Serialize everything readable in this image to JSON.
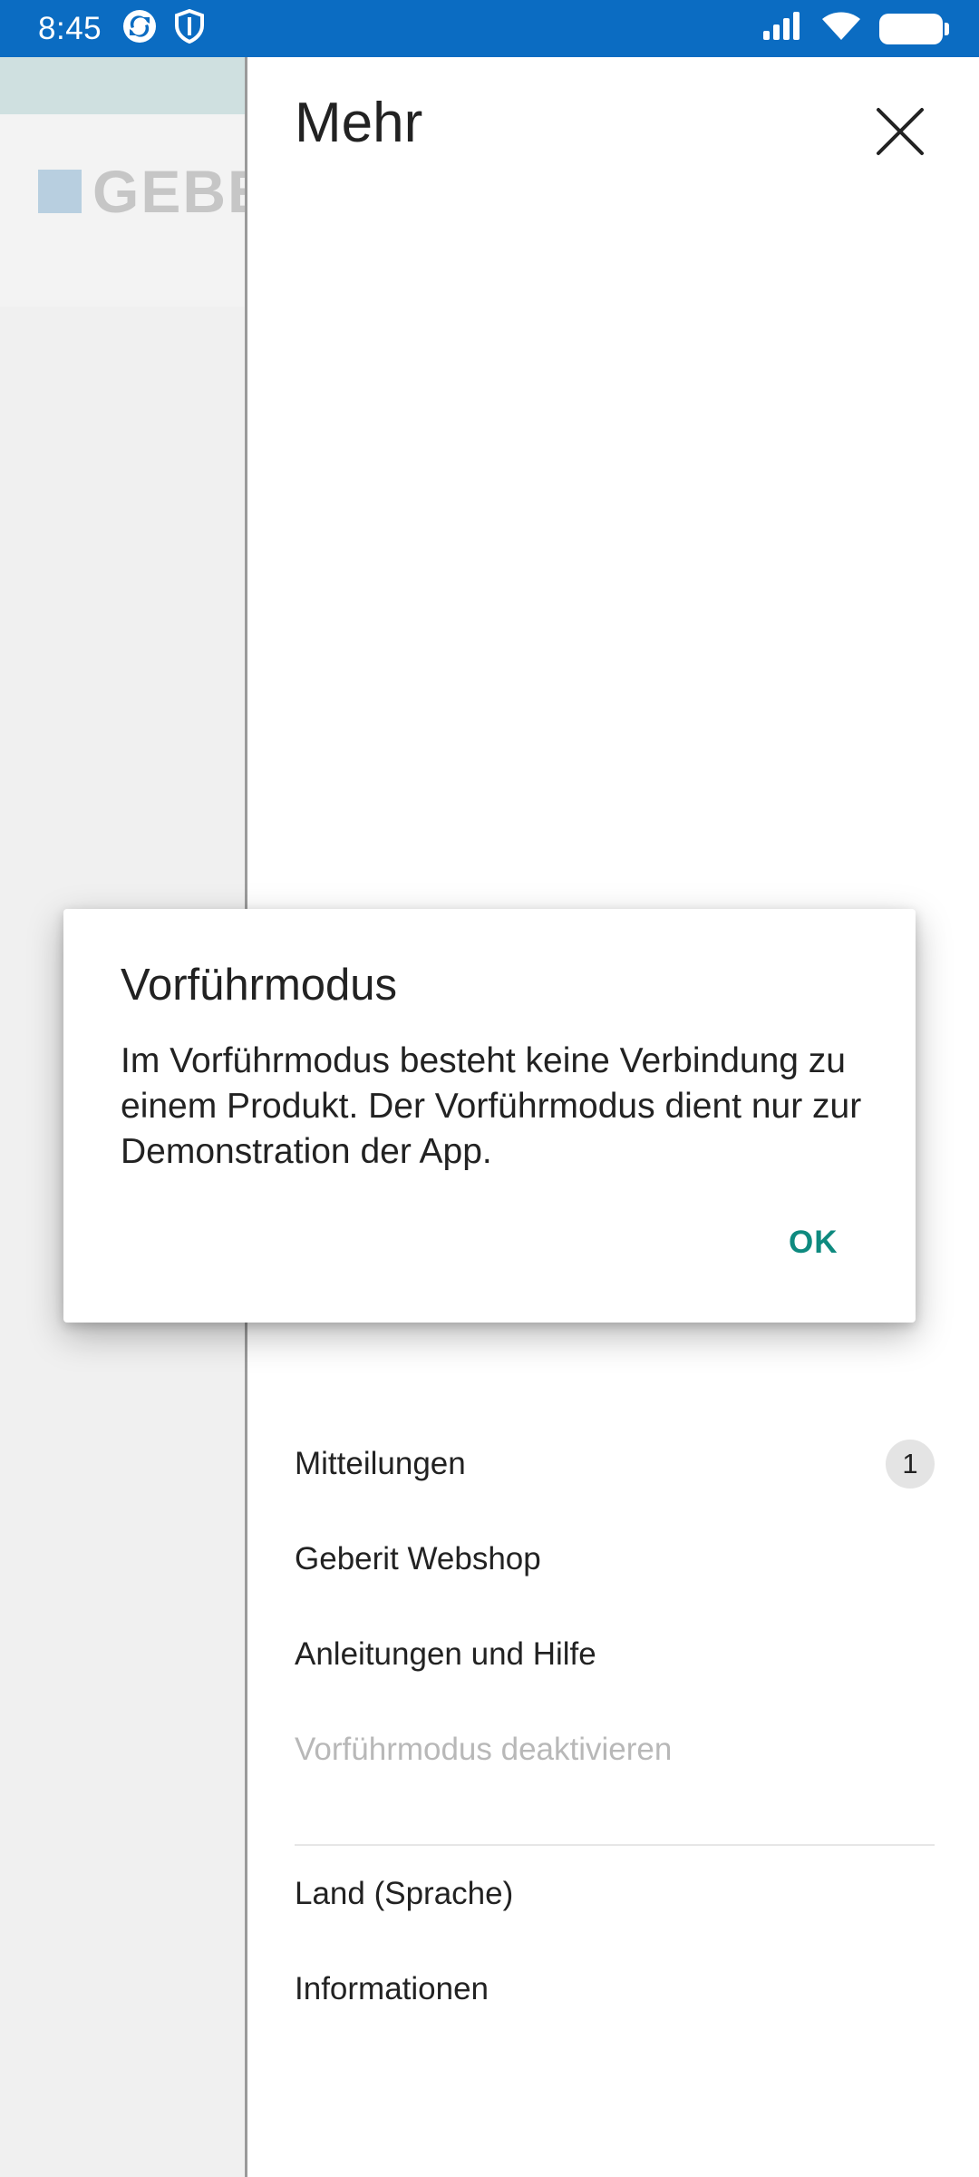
{
  "status_bar": {
    "time": "8:45",
    "icons": [
      "sync-icon",
      "shield-icon",
      "signal-icon",
      "wifi-icon",
      "battery-icon"
    ]
  },
  "background_app": {
    "logo_text": "GEBERIT",
    "logo_color": "#b8cfe0"
  },
  "drawer": {
    "title": "Mehr",
    "close_icon": "close-icon",
    "menu_items": [
      {
        "label": "Mitteilungen",
        "badge": "1",
        "enabled": true
      },
      {
        "label": "Geberit Webshop",
        "enabled": true
      },
      {
        "label": "Anleitungen und Hilfe",
        "enabled": true
      },
      {
        "label": "Vorführmodus deaktivieren",
        "enabled": false
      },
      {
        "label": "Land (Sprache)",
        "enabled": true
      },
      {
        "label": "Informationen",
        "enabled": true
      }
    ]
  },
  "dialog": {
    "title": "Vorführmodus",
    "body": "Im Vorführmodus besteht keine Verbindung zu einem Produkt. Der Vorführmodus dient nur zur Demonstration der App.",
    "ok_label": "OK",
    "ok_color": "#0e8a7f"
  },
  "colors": {
    "status_bar": "#0b6cc2",
    "accent": "#0e8a7f"
  }
}
